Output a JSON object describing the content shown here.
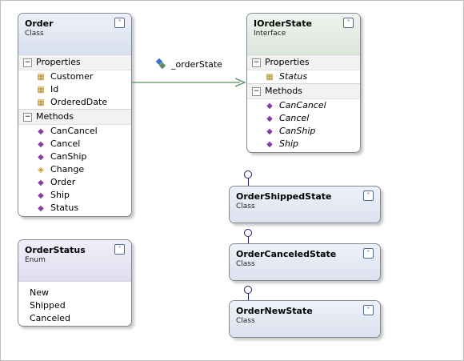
{
  "order": {
    "name": "Order",
    "kind": "Class",
    "properties_label": "Properties",
    "properties": [
      "Customer",
      "Id",
      "OrderedDate"
    ],
    "methods_label": "Methods",
    "methods": [
      "CanCancel",
      "Cancel",
      "CanShip",
      "Change",
      "Order",
      "Ship",
      "Status"
    ]
  },
  "iorderstate": {
    "name": "IOrderState",
    "kind": "Interface",
    "properties_label": "Properties",
    "properties": [
      "Status"
    ],
    "methods_label": "Methods",
    "methods": [
      "CanCancel",
      "Cancel",
      "CanShip",
      "Ship"
    ]
  },
  "association": {
    "label": "_orderState",
    "color": "#5e8f5e"
  },
  "orderstatus": {
    "name": "OrderStatus",
    "kind": "Enum",
    "values": [
      "New",
      "Shipped",
      "Canceled"
    ]
  },
  "states": [
    {
      "name": "OrderShippedState",
      "kind": "Class"
    },
    {
      "name": "OrderCanceledState",
      "kind": "Class"
    },
    {
      "name": "OrderNewState",
      "kind": "Class"
    }
  ],
  "icons": {
    "collapse": "collapse-chevrons-up-icon",
    "expand": "expand-chevrons-down-icon",
    "property": "property-icon",
    "method": "method-icon",
    "protected_method": "protected-method-icon",
    "association": "association-icon",
    "interface": "interface-lollipop-icon"
  }
}
